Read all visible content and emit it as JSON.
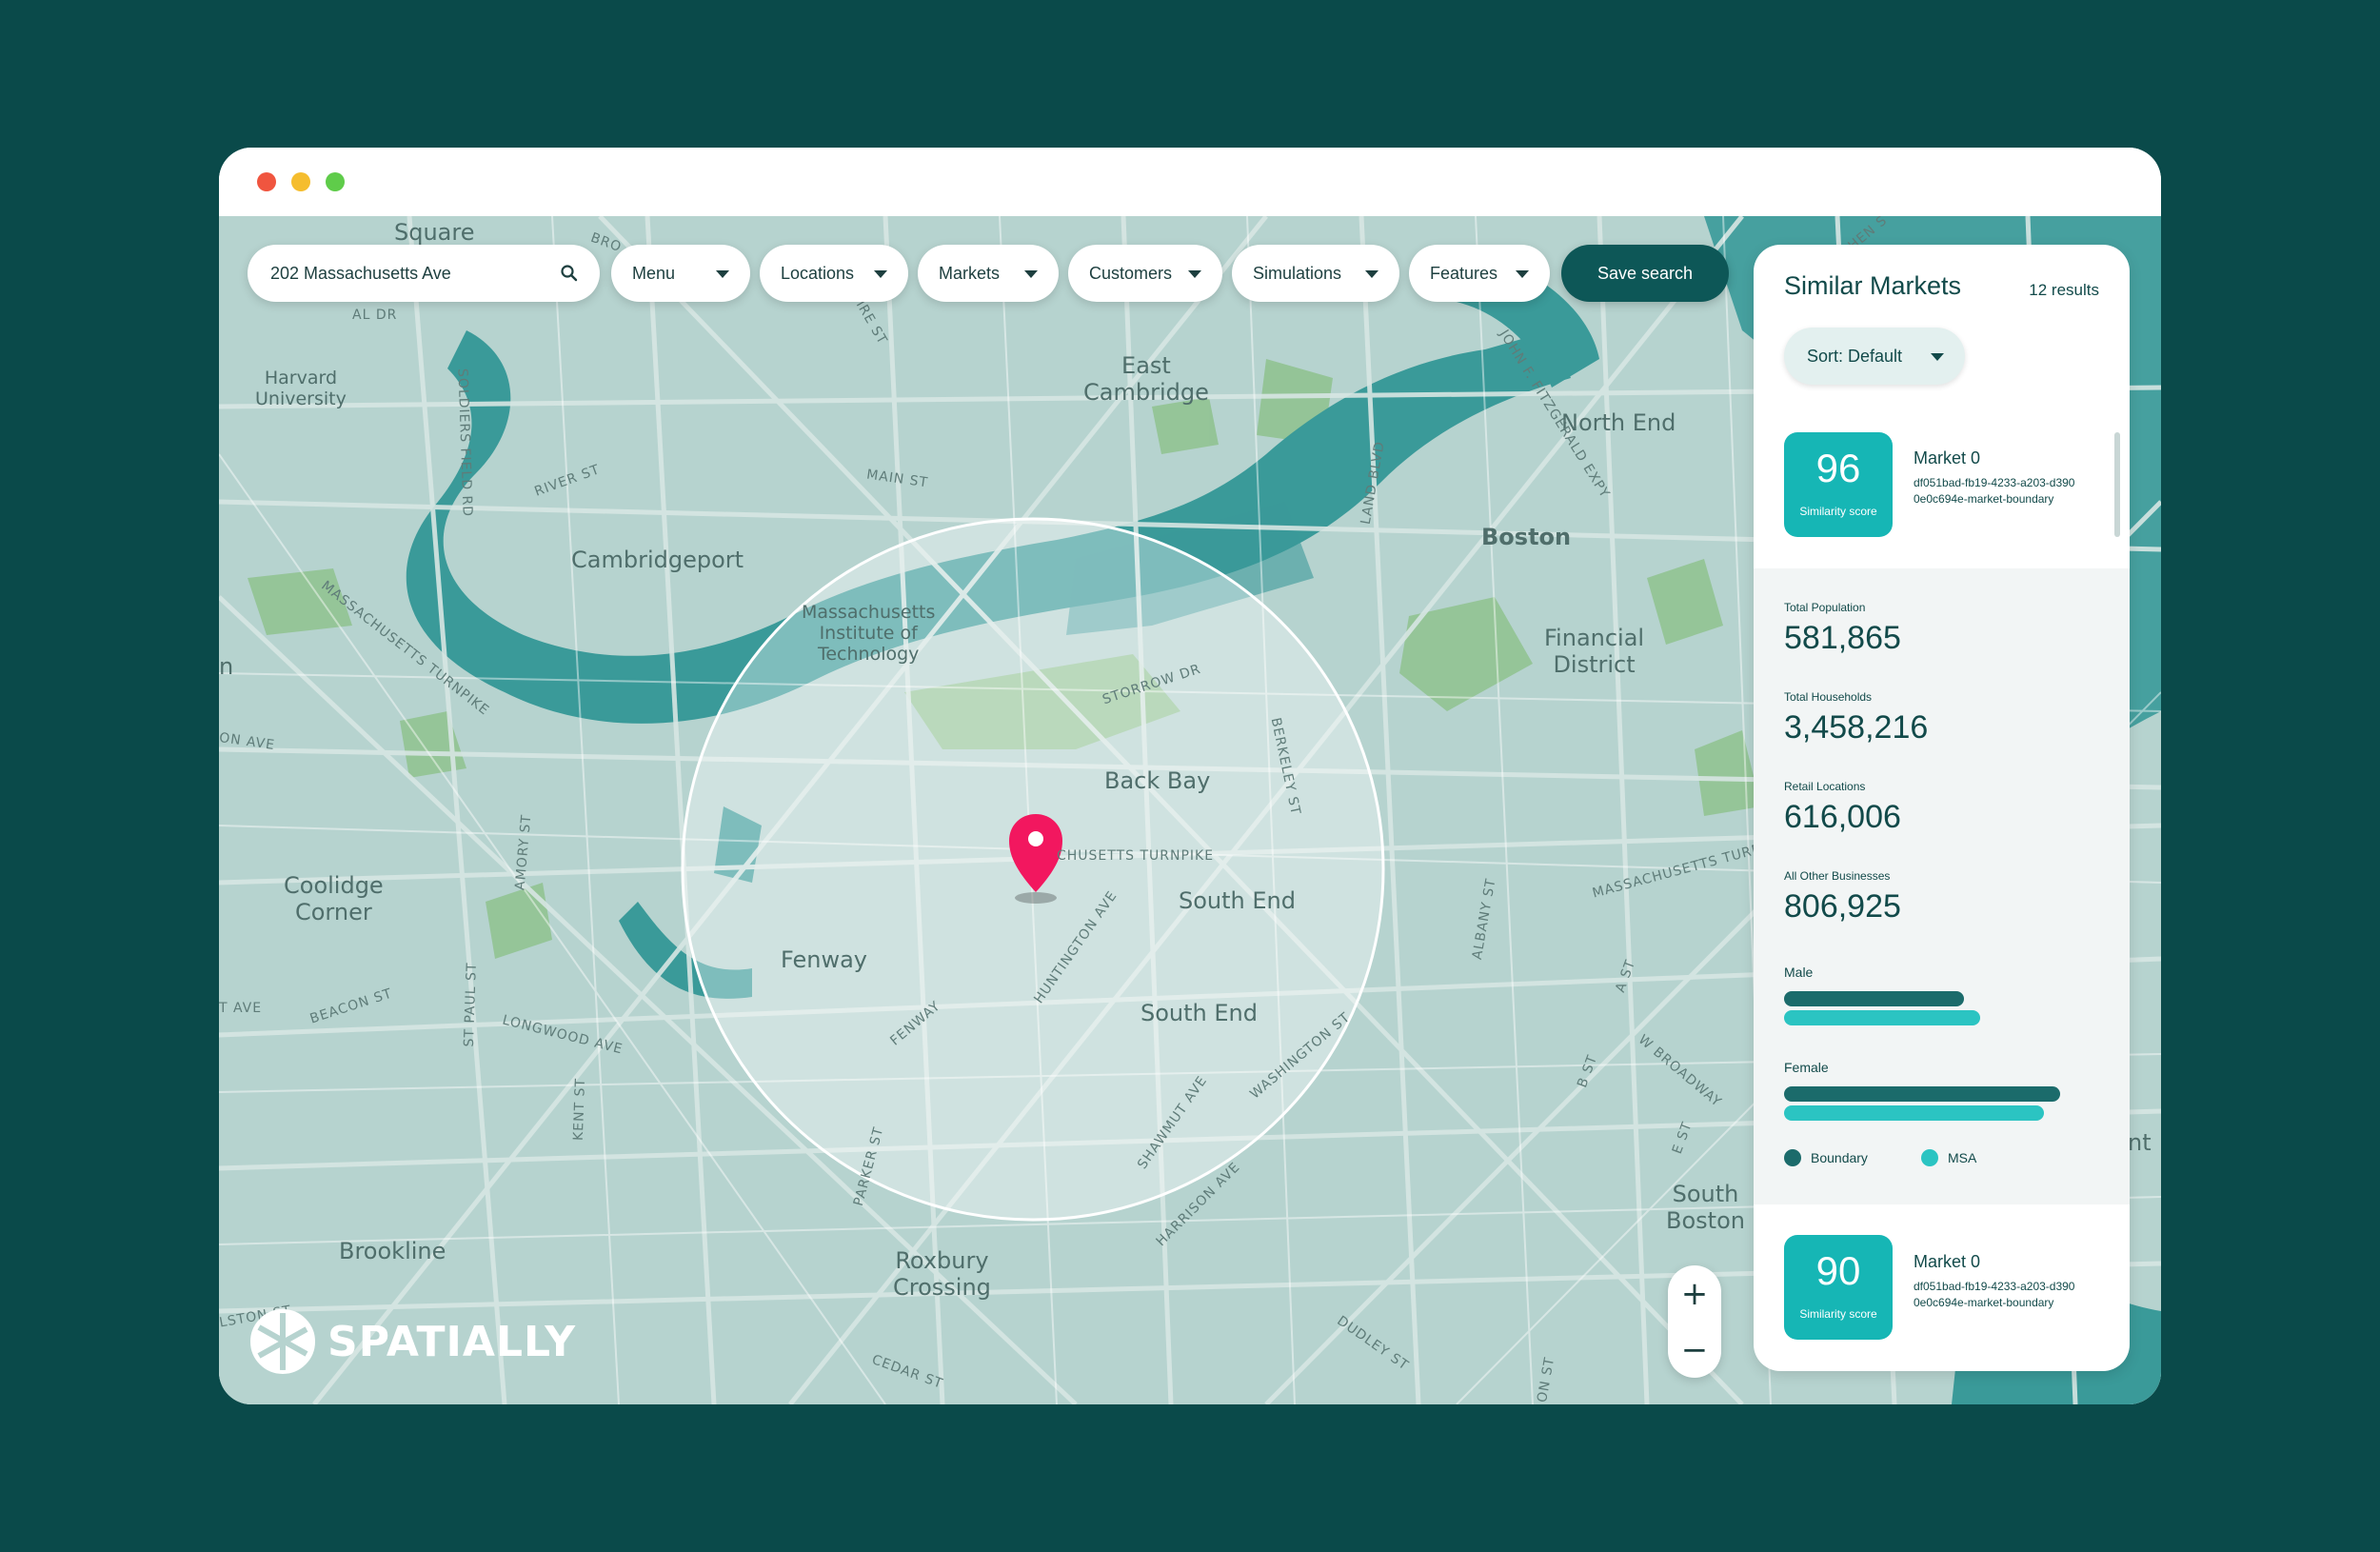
{
  "window": {
    "controls": [
      "close",
      "minimize",
      "maximize"
    ]
  },
  "toolbar": {
    "search_value": "202 Massachusetts Ave",
    "menus": [
      {
        "label": "Menu"
      },
      {
        "label": "Locations"
      },
      {
        "label": "Markets"
      },
      {
        "label": "Customers"
      },
      {
        "label": "Simulations"
      },
      {
        "label": "Features"
      }
    ],
    "save_label": "Save search"
  },
  "map": {
    "labels": {
      "square": "Square",
      "harvard": "Harvard\nUniversity",
      "east_cambridge": "East\nCambridge",
      "north_end": "North End",
      "cambridgeport": "Cambridgeport",
      "boston": "Boston",
      "mit": "Massachusetts\nInstitute of\nTechnology",
      "financial_district": "Financial\nDistrict",
      "back_bay": "Back Bay",
      "south_end_1": "South End",
      "south_end_2": "South End",
      "coolidge_corner": "Coolidge\nCorner",
      "fenway": "Fenway",
      "brookline": "Brookline",
      "roxbury_crossing": "Roxbury\nCrossing",
      "south_boston": "South\nBoston"
    },
    "streets": {
      "river_st": "RIVER ST",
      "main_st": "MAIN ST",
      "land_blvd": "LAND BLVD",
      "soldiers_field": "SOLDIERS FIELD RD",
      "mass_tpk_w": "MASSACHUSETTS TURNPIKE",
      "storrow": "STORROW DR",
      "mass_tpk_c": "CHUSETTS TURNPIKE",
      "berkeley": "BERKELEY ST",
      "huntington": "HUNTINGTON AVE",
      "fenway_st": "FENWAY",
      "amory": "AMORY ST",
      "beacon": "BEACON ST",
      "st_paul": "ST PAUL ST",
      "longwood": "LONGWOOD AVE",
      "kent": "KENT ST",
      "parker": "PARKER ST",
      "shawmut": "SHAWMUT AVE",
      "washington": "WASHINGTON ST",
      "harrison": "HARRISON AVE",
      "albany": "ALBANY ST",
      "a_st": "A ST",
      "b_st": "B ST",
      "e_st": "E ST",
      "w_broadway": "W BROADWAY",
      "mass_tpk_e": "MASSACHUSETTS TURN",
      "dudley": "DUDLEY ST",
      "cedar": "CEDAR ST",
      "jf_fitz": "JOHN F. FITZGERALD EXPY",
      "on_ave": "ON AVE",
      "t_ave": "T AVE",
      "lston_st": "LSTON ST",
      "al_dr": "AL DR",
      "ire_st": "IRE ST",
      "bro": "BRO",
      "mass_ave": "MASSACHUSETTS",
      "hen": "HEN S",
      "on_st": "ON ST"
    },
    "edge_left": "n",
    "edge_right": "nt",
    "brand": "SPATIALLY",
    "zoom_in": "+",
    "zoom_out": "−"
  },
  "panel": {
    "title": "Similar Markets",
    "count": "12 results",
    "sort_label": "Sort: Default",
    "markets": [
      {
        "score": "96",
        "score_label": "Similarity score",
        "name": "Market 0",
        "id": "df051bad-fb19-4233-a203-d3900e0c694e-market-boundary"
      },
      {
        "score": "90",
        "score_label": "Similarity score",
        "name": "Market 0",
        "id": "df051bad-fb19-4233-a203-d3900e0c694e-market-boundary"
      }
    ],
    "stats": [
      {
        "label": "Total Population",
        "value": "581,865"
      },
      {
        "label": "Total Households",
        "value": "3,458,216"
      },
      {
        "label": "Retail Locations",
        "value": "616,006"
      },
      {
        "label": "All Other Businesses",
        "value": "806,925"
      }
    ],
    "demographics": [
      {
        "label": "Male",
        "boundary": 0.65,
        "msa": 0.71
      },
      {
        "label": "Female",
        "boundary": 1.0,
        "msa": 0.94
      }
    ],
    "legend": [
      {
        "label": "Boundary",
        "color": "#1b6b6b"
      },
      {
        "label": "MSA",
        "color": "#2bc4c2"
      }
    ]
  },
  "colors": {
    "background": "#0a4a4a",
    "water": "#3a9a99",
    "park": "#8fc28e",
    "land": "#b6d3cf",
    "pin": "#f2175f",
    "accent": "#16b6b5",
    "save_button": "#0d5757"
  }
}
